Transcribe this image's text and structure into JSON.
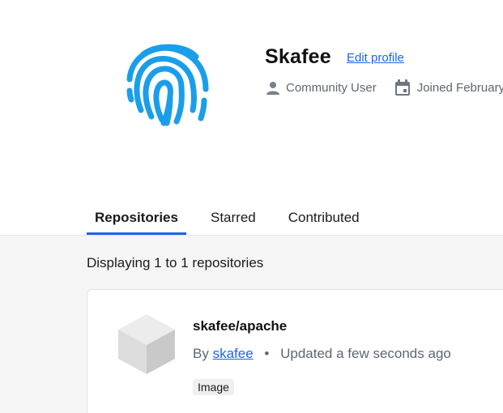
{
  "profile": {
    "username": "Skafee",
    "edit_label": "Edit profile",
    "role": "Community User",
    "joined": "Joined February"
  },
  "tabs": [
    {
      "label": "Repositories",
      "active": true
    },
    {
      "label": "Starred",
      "active": false
    },
    {
      "label": "Contributed",
      "active": false
    }
  ],
  "list": {
    "summary": "Displaying 1 to 1 repositories",
    "repos": [
      {
        "name": "skafee/apache",
        "by_prefix": "By",
        "owner": "skafee",
        "separator": "•",
        "updated": "Updated a few seconds ago",
        "badge": "Image"
      }
    ]
  },
  "colors": {
    "accent": "#1d63ed",
    "fingerprint": "#1a9eea",
    "muted_text": "#5d6670",
    "page_bg": "#f5f5f5"
  },
  "icons": {
    "avatar": "fingerprint-icon",
    "role": "user-icon",
    "joined": "calendar-icon",
    "repo": "cube-icon"
  }
}
